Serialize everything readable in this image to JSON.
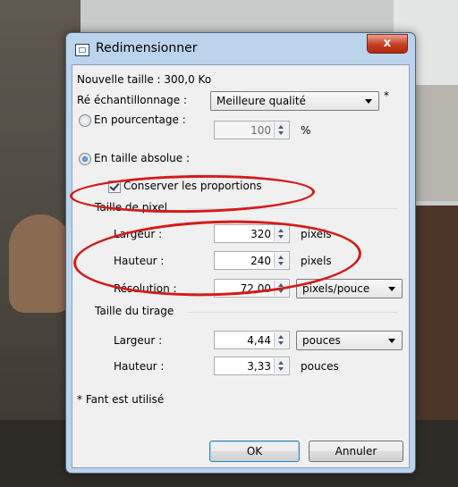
{
  "dialog": {
    "title": "Redimensionner",
    "close_label": "x",
    "new_size": "Nouvelle taille : 300,0 Ko",
    "resampling_label": "Ré échantillonnage :",
    "resampling_value": "Meilleure qualité",
    "resampling_asterisk": "*",
    "by_percent_label": "En pourcentage :",
    "percent_value": "100",
    "percent_unit": "%",
    "absolute_label": "En taille absolue :",
    "keep_ratio_label": "Conserver les proportions",
    "pixel_size_group": "Taille de pixel",
    "width_label": "Largeur :",
    "width_value": "320",
    "height_label": "Hauteur :",
    "height_value": "240",
    "pixels_unit": "pixels",
    "resolution_label": "Résolution :",
    "resolution_value": "72,00",
    "resolution_unit": "pixels/pouce",
    "print_size_group": "Taille du tirage",
    "print_width_label": "Largeur :",
    "print_width_value": "4,44",
    "print_width_unit": "pouces",
    "print_height_label": "Hauteur :",
    "print_height_value": "3,33",
    "print_height_unit": "pouces",
    "footnote": "* Fant est utilisé",
    "ok_label": "OK",
    "cancel_label": "Annuler"
  },
  "colors": {
    "annotation_red": "#d51a1a",
    "frame_blue": "#bcd3ec",
    "close_red": "#c63e20"
  },
  "icons": [
    "resize-window-icon",
    "close-icon",
    "dropdown-arrow-icon",
    "spin-arrows-icon"
  ]
}
